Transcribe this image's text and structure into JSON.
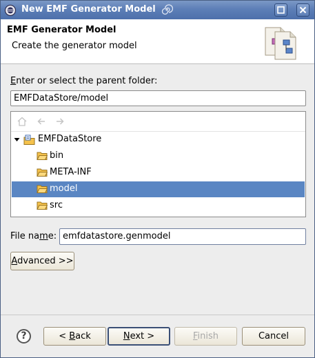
{
  "window": {
    "title": "New EMF Generator Model"
  },
  "header": {
    "title": "EMF Generator Model",
    "description": "Create the generator model"
  },
  "parent_folder": {
    "label_prefix": "",
    "label_mnemonic": "E",
    "label_rest": "nter or select the parent folder:",
    "value": "EMFDataStore/model"
  },
  "tree": {
    "items": [
      {
        "label": "EMFDataStore",
        "level": 0,
        "expanded": true,
        "type": "project",
        "selected": false
      },
      {
        "label": "bin",
        "level": 1,
        "type": "folder",
        "selected": false
      },
      {
        "label": "META-INF",
        "level": 1,
        "type": "folder",
        "selected": false
      },
      {
        "label": "model",
        "level": 1,
        "type": "folder",
        "selected": true
      },
      {
        "label": "src",
        "level": 1,
        "type": "folder",
        "selected": false
      }
    ]
  },
  "file_name": {
    "label_prefix": "File na",
    "label_mnemonic": "m",
    "label_rest": "e:",
    "value": "emfdatastore.genmodel"
  },
  "advanced_button": {
    "mnemonic": "A",
    "rest": "dvanced >>"
  },
  "buttons": {
    "back_pre": "< ",
    "back_mn": "B",
    "back_rest": "ack",
    "next_mn": "N",
    "next_rest": "ext >",
    "finish_mn": "F",
    "finish_rest": "inish",
    "cancel": "Cancel"
  },
  "help": "?",
  "colors": {
    "titlebar": "#5d7fb7",
    "selection": "#5a86c3",
    "folder": "#f5c24c"
  }
}
